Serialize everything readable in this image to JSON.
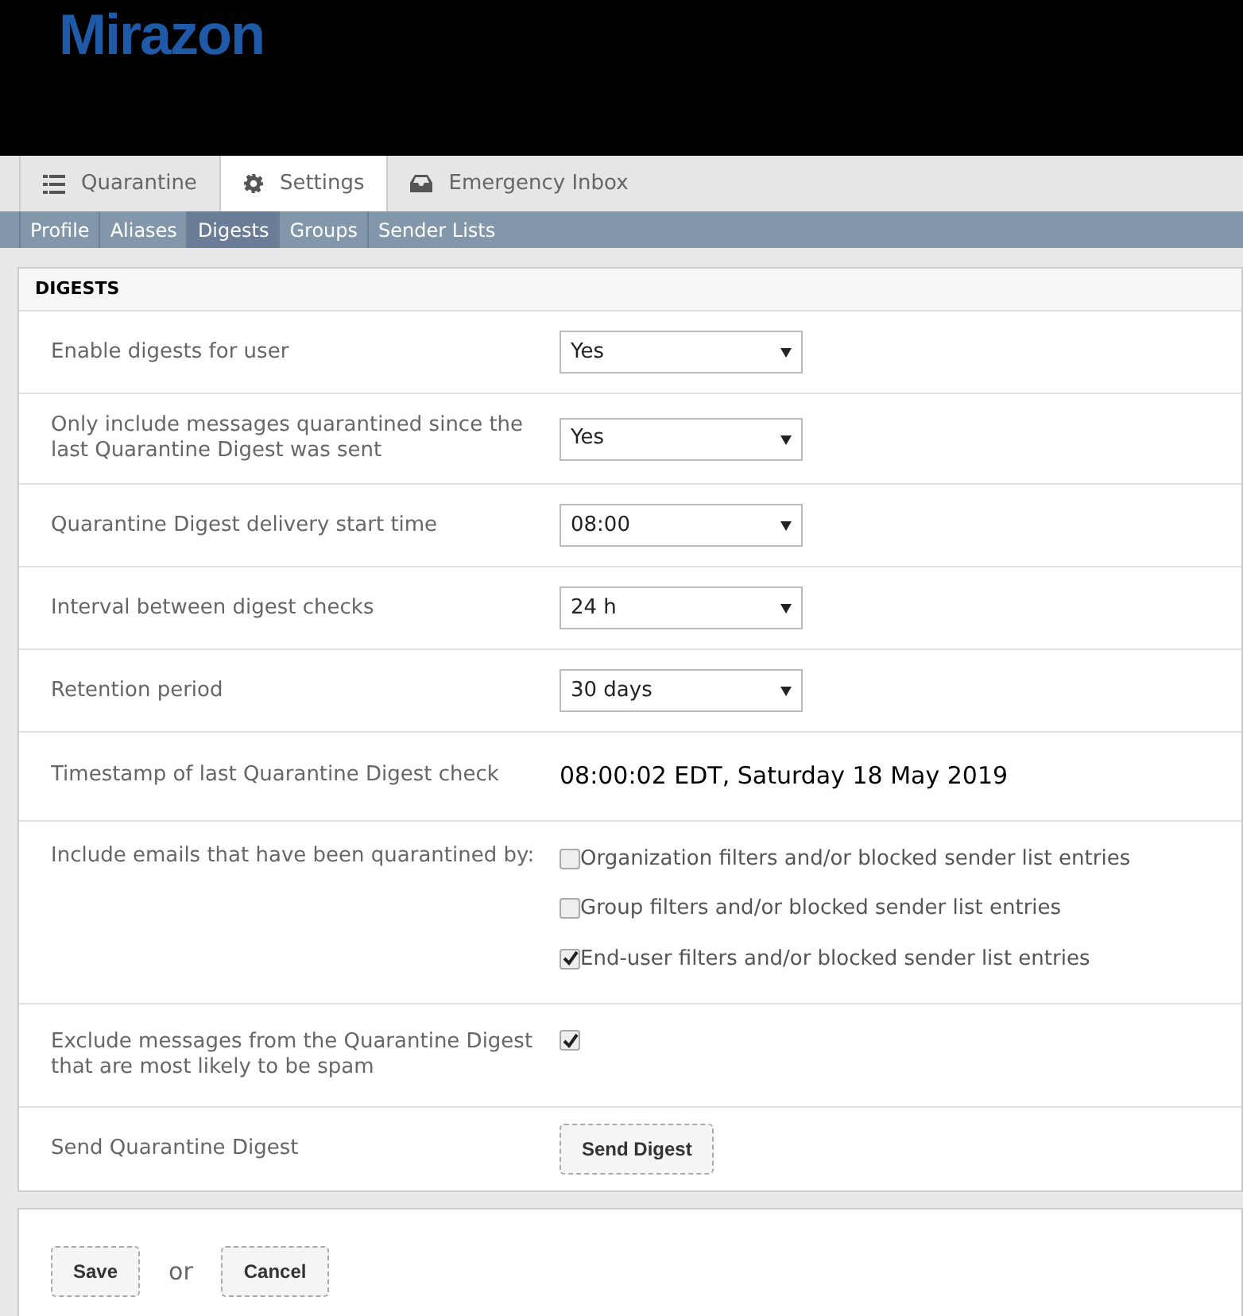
{
  "logo": {
    "text": "Mirazon"
  },
  "tabs": [
    {
      "label": "Quarantine",
      "kind": "list",
      "selected": false
    },
    {
      "label": "Settings",
      "kind": "gear",
      "selected": true
    },
    {
      "label": "Emergency Inbox",
      "kind": "inbox",
      "selected": false
    }
  ],
  "subtabs": [
    {
      "label": "Profile",
      "selected": false
    },
    {
      "label": "Aliases",
      "selected": false
    },
    {
      "label": "Digests",
      "selected": true
    },
    {
      "label": "Groups",
      "selected": false
    },
    {
      "label": "Sender Lists",
      "selected": false
    }
  ],
  "panel": {
    "title": "DIGESTS",
    "rows": [
      {
        "kind": "select",
        "label": "Enable digests for user",
        "value": "Yes"
      },
      {
        "kind": "select",
        "label": "Only include messages quarantined since the last Quarantine Digest was sent",
        "value": "Yes"
      },
      {
        "kind": "select",
        "label": "Quarantine Digest delivery start time",
        "value": "08:00"
      },
      {
        "kind": "select",
        "label": "Interval between digest checks",
        "value": "24 h"
      },
      {
        "kind": "select",
        "label": "Retention period",
        "value": "30 days"
      },
      {
        "kind": "text",
        "label": "Timestamp of last Quarantine Digest check",
        "value": "08:00:02 EDT, Saturday 18 May 2019"
      },
      {
        "kind": "checkboxes",
        "label": "Include emails that have been quarantined by:",
        "options": [
          {
            "label": "Organization filters and/or blocked sender list entries",
            "checked": false
          },
          {
            "label": "Group filters and/or blocked sender list entries",
            "checked": false
          },
          {
            "label": "End-user filters and/or blocked sender list entries",
            "checked": true
          }
        ]
      },
      {
        "kind": "checkbox",
        "label": "Exclude messages from the Quarantine Digest that are most likely to be spam",
        "checked": true
      },
      {
        "kind": "button",
        "label": "Send Quarantine Digest",
        "button": "Send Digest"
      }
    ]
  },
  "footer": {
    "save": "Save",
    "or": "or",
    "cancel": "Cancel"
  }
}
